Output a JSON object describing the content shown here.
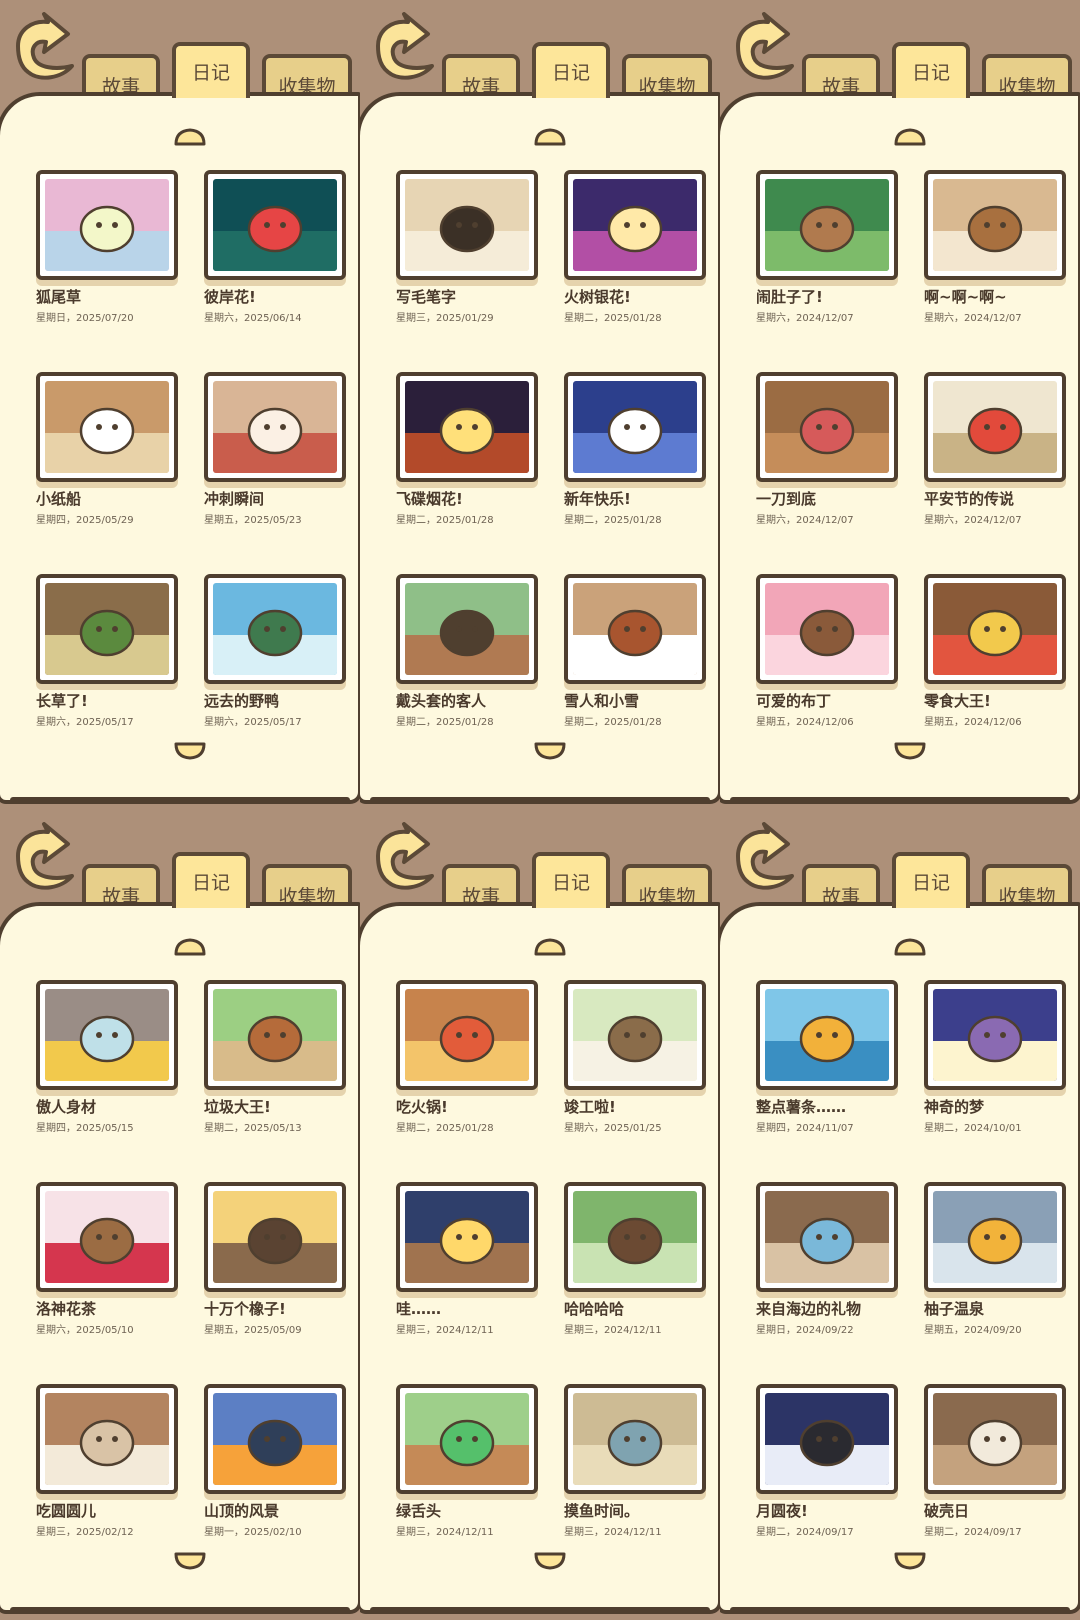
{
  "tabs": {
    "story": "故事",
    "diary": "日记",
    "collection": "收集物"
  },
  "icons": {
    "back": "back-arrow-icon",
    "up": "page-up-icon",
    "down": "page-down-icon"
  },
  "colors": {
    "background": "#ad9079",
    "paper": "#fef9df",
    "active_tab": "#fde69a",
    "tab": "#e7cf8a",
    "ink": "#4f3f2f"
  },
  "panels": [
    {
      "entries": [
        {
          "title": "狐尾草",
          "date": "星期日，2025/07/20",
          "palette": [
            "#e9b8d4",
            "#b9d4e9",
            "#f3f7c9"
          ]
        },
        {
          "title": "彼岸花!",
          "date": "星期六，2025/06/14",
          "palette": [
            "#0f4f55",
            "#1f6d64",
            "#e64545"
          ]
        },
        {
          "title": "小纸船",
          "date": "星期四，2025/05/29",
          "palette": [
            "#c99a6a",
            "#e8d2a8",
            "#ffffff"
          ]
        },
        {
          "title": "冲刺瞬间",
          "date": "星期五，2025/05/23",
          "palette": [
            "#d9b596",
            "#c95d4c",
            "#fbf0e4"
          ]
        },
        {
          "title": "长草了!",
          "date": "星期六，2025/05/17",
          "palette": [
            "#8a6d4a",
            "#d8c98f",
            "#5b8a3e"
          ]
        },
        {
          "title": "远去的野鸭",
          "date": "星期六，2025/05/17",
          "palette": [
            "#6bb8e0",
            "#d8f0f7",
            "#3f7a4e"
          ]
        }
      ]
    },
    {
      "entries": [
        {
          "title": "写毛笔字",
          "date": "星期三，2025/01/29",
          "palette": [
            "#e7d5b4",
            "#f5ecd8",
            "#3b3026"
          ]
        },
        {
          "title": "火树银花!",
          "date": "星期二，2025/01/28",
          "palette": [
            "#3c2a6b",
            "#b24fa5",
            "#ffe9a8"
          ]
        },
        {
          "title": "飞碟烟花!",
          "date": "星期二，2025/01/28",
          "palette": [
            "#2b1f3a",
            "#b34a2a",
            "#ffe07a"
          ]
        },
        {
          "title": "新年快乐!",
          "date": "星期二，2025/01/28",
          "palette": [
            "#2c3f8c",
            "#5d7bd1",
            "#ffffff"
          ]
        },
        {
          "title": "戴头套的客人",
          "date": "星期二，2025/01/28",
          "palette": [
            "#8fbf88",
            "#b07a52",
            "#4f3f2f"
          ]
        },
        {
          "title": "雪人和小雪",
          "date": "星期二，2025/01/28",
          "palette": [
            "#caa27a",
            "#ffffff",
            "#a8552f"
          ]
        }
      ]
    },
    {
      "entries": [
        {
          "title": "闹肚子了!",
          "date": "星期六，2024/12/07",
          "palette": [
            "#3f8a4e",
            "#7dbb6a",
            "#b07a4e"
          ]
        },
        {
          "title": "啊~啊~啊~",
          "date": "星期六，2024/12/07",
          "palette": [
            "#d9b991",
            "#f3e6cf",
            "#a8703f"
          ]
        },
        {
          "title": "一刀到底",
          "date": "星期六，2024/12/07",
          "palette": [
            "#9b6c43",
            "#c58d5a",
            "#d65a5a"
          ]
        },
        {
          "title": "平安节的传说",
          "date": "星期六，2024/12/07",
          "palette": [
            "#efe6d0",
            "#c9b386",
            "#e24a3b"
          ]
        },
        {
          "title": "可爱的布丁",
          "date": "星期五，2024/12/06",
          "palette": [
            "#f2a6b8",
            "#fbd5de",
            "#8a5a3a"
          ]
        },
        {
          "title": "零食大王!",
          "date": "星期五，2024/12/06",
          "palette": [
            "#8a5a38",
            "#e2553f",
            "#f2c94c"
          ]
        }
      ]
    },
    {
      "entries": [
        {
          "title": "傲人身材",
          "date": "星期四，2025/05/15",
          "palette": [
            "#9a8d86",
            "#f2c94c",
            "#bfe0e8"
          ]
        },
        {
          "title": "垃圾大王!",
          "date": "星期二，2025/05/13",
          "palette": [
            "#9ccf83",
            "#d8bb8a",
            "#b56b3a"
          ]
        },
        {
          "title": "洛神花茶",
          "date": "星期六，2025/05/10",
          "palette": [
            "#f7e2e7",
            "#d5364e",
            "#9b6c43"
          ]
        },
        {
          "title": "十万个橡子!",
          "date": "星期五，2025/05/09",
          "palette": [
            "#f4d27a",
            "#8a6a4c",
            "#5a4332"
          ]
        },
        {
          "title": "吃圆圆儿",
          "date": "星期三，2025/02/12",
          "palette": [
            "#b38460",
            "#f3ead9",
            "#d9c3a6"
          ]
        },
        {
          "title": "山顶的风景",
          "date": "星期一，2025/02/10",
          "palette": [
            "#5c7fc4",
            "#f6a23a",
            "#2f3f59"
          ]
        }
      ]
    },
    {
      "entries": [
        {
          "title": "吃火锅!",
          "date": "星期二，2025/01/28",
          "palette": [
            "#c7834c",
            "#f3c46a",
            "#e25c3a"
          ]
        },
        {
          "title": "竣工啦!",
          "date": "星期六，2025/01/25",
          "palette": [
            "#d8e9c0",
            "#f6f2e4",
            "#8a6c4a"
          ]
        },
        {
          "title": "哇……",
          "date": "星期三，2024/12/11",
          "palette": [
            "#2f3f6b",
            "#a0734f",
            "#ffd86a"
          ]
        },
        {
          "title": "哈哈哈哈",
          "date": "星期三，2024/12/11",
          "palette": [
            "#7fb56c",
            "#c9e3b3",
            "#6b4a33"
          ]
        },
        {
          "title": "绿舌头",
          "date": "星期三，2024/12/11",
          "palette": [
            "#9ecf8a",
            "#c58a57",
            "#55c06b"
          ]
        },
        {
          "title": "摸鱼时间。",
          "date": "星期三，2024/12/11",
          "palette": [
            "#cdbb94",
            "#e9dcb9",
            "#7fa3b0"
          ]
        }
      ]
    },
    {
      "entries": [
        {
          "title": "整点薯条……",
          "date": "星期四，2024/11/07",
          "palette": [
            "#7fc6e8",
            "#3a8fc2",
            "#f2b13a"
          ]
        },
        {
          "title": "神奇的梦",
          "date": "星期二，2024/10/01",
          "palette": [
            "#3c3f8c",
            "#fdf4cf",
            "#8a6ab2"
          ]
        },
        {
          "title": "来自海边的礼物",
          "date": "星期日，2024/09/22",
          "palette": [
            "#8a6a4e",
            "#d9c2a4",
            "#7ab8d9"
          ]
        },
        {
          "title": "柚子温泉",
          "date": "星期五，2024/09/20",
          "palette": [
            "#8aa0b6",
            "#d9e4ec",
            "#f2b33a"
          ]
        },
        {
          "title": "月圆夜!",
          "date": "星期二，2024/09/17",
          "palette": [
            "#2c3466",
            "#e8ecf7",
            "#2a2a30"
          ]
        },
        {
          "title": "破壳日",
          "date": "星期二，2024/09/17",
          "palette": [
            "#8a6a4e",
            "#c4a27e",
            "#f2eadb"
          ]
        }
      ]
    }
  ]
}
